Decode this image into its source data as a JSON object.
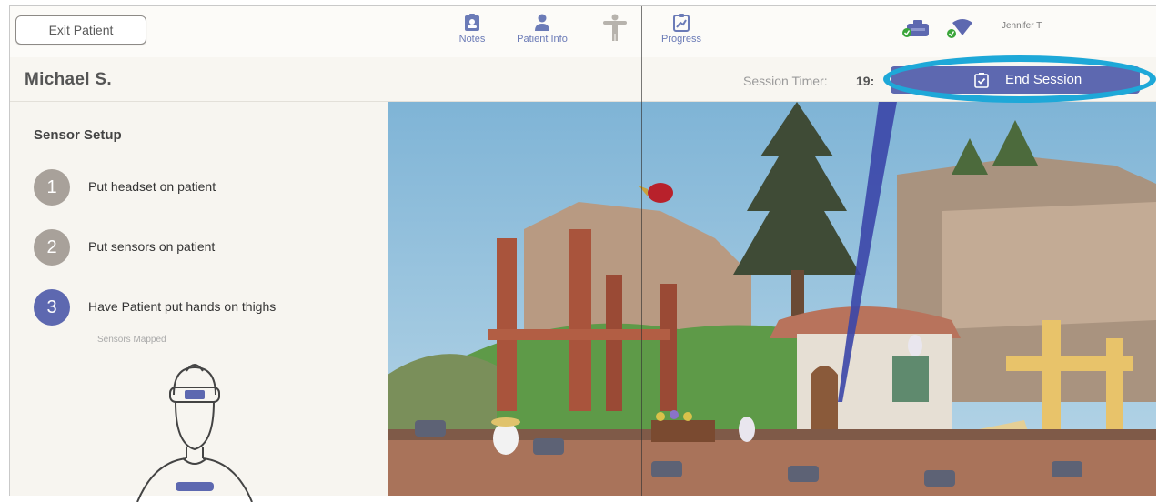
{
  "header": {
    "exit_label": "Exit Patient",
    "nav": [
      {
        "label": "Notes",
        "icon": "notes-icon"
      },
      {
        "label": "Patient Info",
        "icon": "person-icon"
      },
      {
        "label": "",
        "icon": "body-map-icon"
      },
      {
        "label": "Progress",
        "icon": "progress-icon"
      }
    ],
    "user_name": "Jennifer T."
  },
  "patient": {
    "name": "Michael S."
  },
  "session": {
    "timer_label": "Session Timer:",
    "timer_value": "19:",
    "end_label": "End Session"
  },
  "sensor_setup": {
    "title": "Sensor Setup",
    "steps": [
      {
        "num": "1",
        "text": "Put headset on patient"
      },
      {
        "num": "2",
        "text": "Put sensors on patient"
      },
      {
        "num": "3",
        "text": "Have Patient put hands on thighs"
      }
    ],
    "status": "Sensors Mapped"
  },
  "colors": {
    "accent": "#5d68b0",
    "highlight": "#1ea8d8",
    "step_done": "#a8a19a",
    "step_active": "#5d68b0",
    "connected": "#3aa53a"
  }
}
